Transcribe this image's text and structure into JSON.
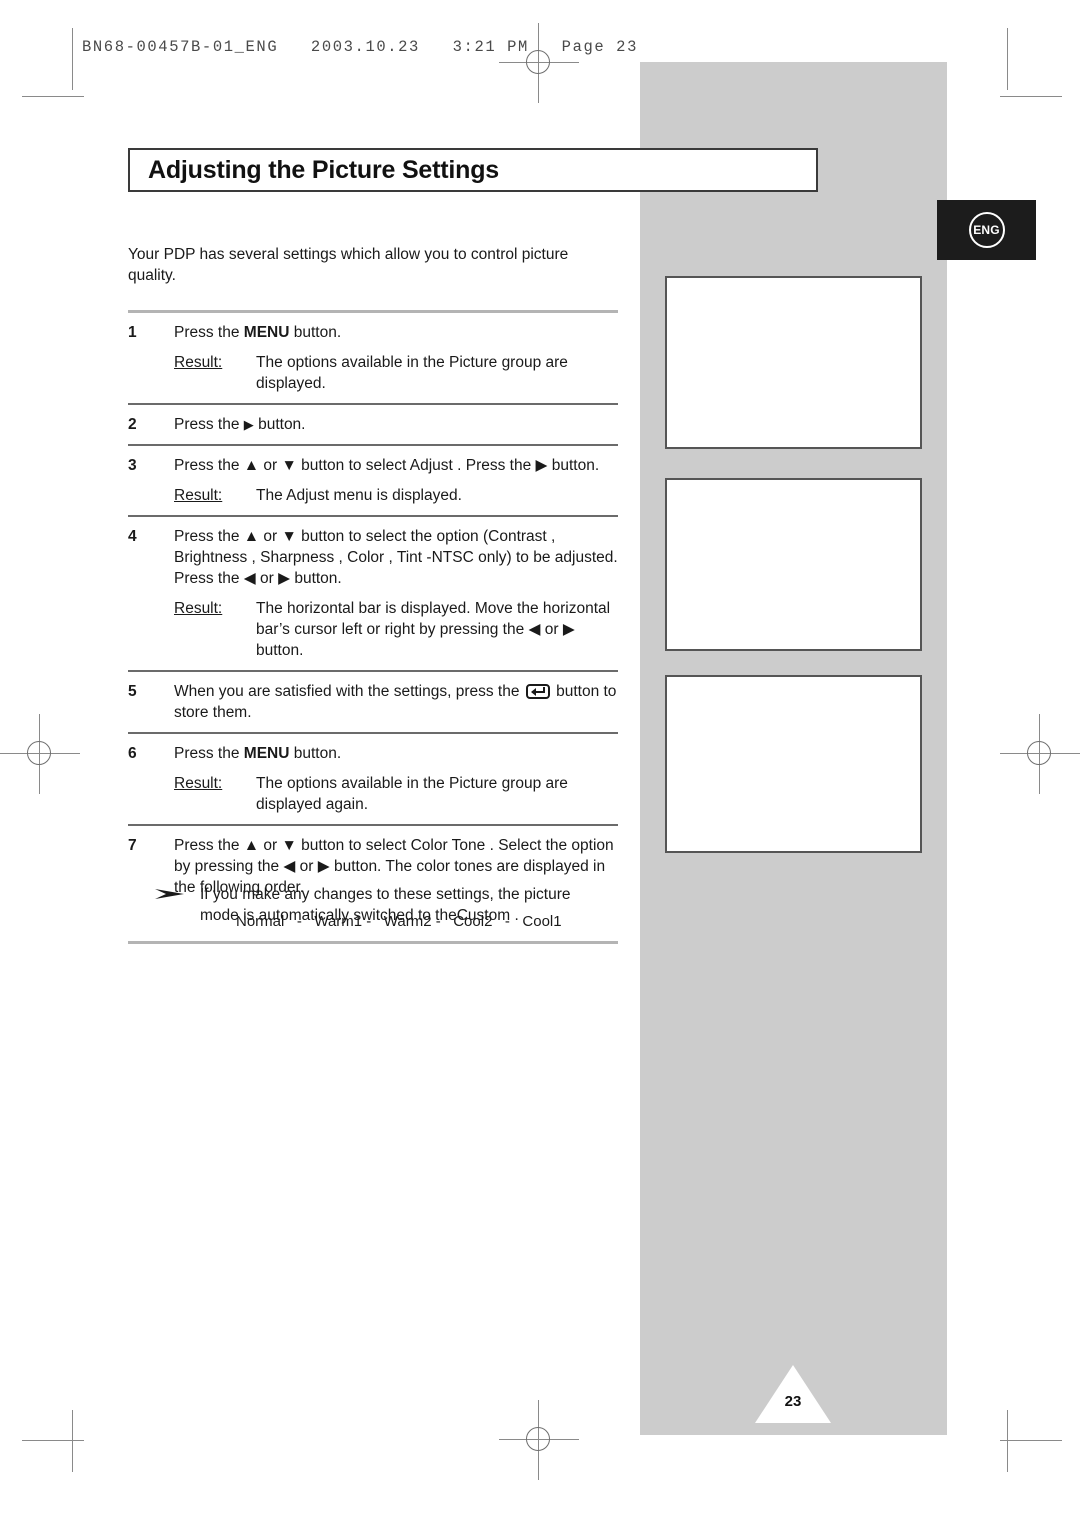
{
  "print_slug": "BN68-00457B-01_ENG   2003.10.23   3:21 PM   Page 23",
  "language_badge": "ENG",
  "page_number": "23",
  "title": "Adjusting the Picture Settings",
  "intro": "Your PDP has several settings which allow you to control picture quality.",
  "result_label": "Result:",
  "steps": [
    {
      "num": "1",
      "main_pre": "Press the ",
      "main_kw": "MENU",
      "main_post": " button.",
      "result": "The options available in the Picture    group are displayed."
    },
    {
      "num": "2",
      "main_pre": "Press the ",
      "main_glyph": "▶",
      "main_post": " button.",
      "result": ""
    },
    {
      "num": "3",
      "main": "Press the ▲ or ▼ button to select Adjust  . Press the ▶ button.",
      "result": "The Adjust   menu is displayed."
    },
    {
      "num": "4",
      "main": "Press the ▲ or ▼ button to select the option (Contrast   , Brightness    , Sharpness   , Color   , Tint   -NTSC only) to be adjusted. Press the ◀ or ▶ button.",
      "result": "The horizontal bar is displayed. Move the horizontal bar’s cursor left or right by pressing the ◀ or ▶ button."
    },
    {
      "num": "5",
      "main_pre": "When you are satisfied with the settings, press the ",
      "main_post": " button to store them.",
      "result": ""
    },
    {
      "num": "6",
      "main_pre": "Press the ",
      "main_kw": "MENU",
      "main_post": " button.",
      "result": "The options available in the Picture    group are displayed again."
    },
    {
      "num": "7",
      "main": "Press the ▲ or ▼ button to select Color Tone   . Select the option by pressing the ◀ or ▶ button. The color tones are displayed in the following order.",
      "order": "Normal   -   Warm1 -   Warm2 -   Cool2   -   Cool1",
      "result": ""
    }
  ],
  "note": {
    "text_line1": "If you make any changes to these settings, the picture",
    "text_line2": "mode is automatically switched to theCustom ."
  },
  "colors": {
    "panel_gray": "#cccccc",
    "badge_black": "#1c1c1c",
    "rule_thick": "#b4b4b4",
    "rule_thin": "#6b6b6b"
  }
}
